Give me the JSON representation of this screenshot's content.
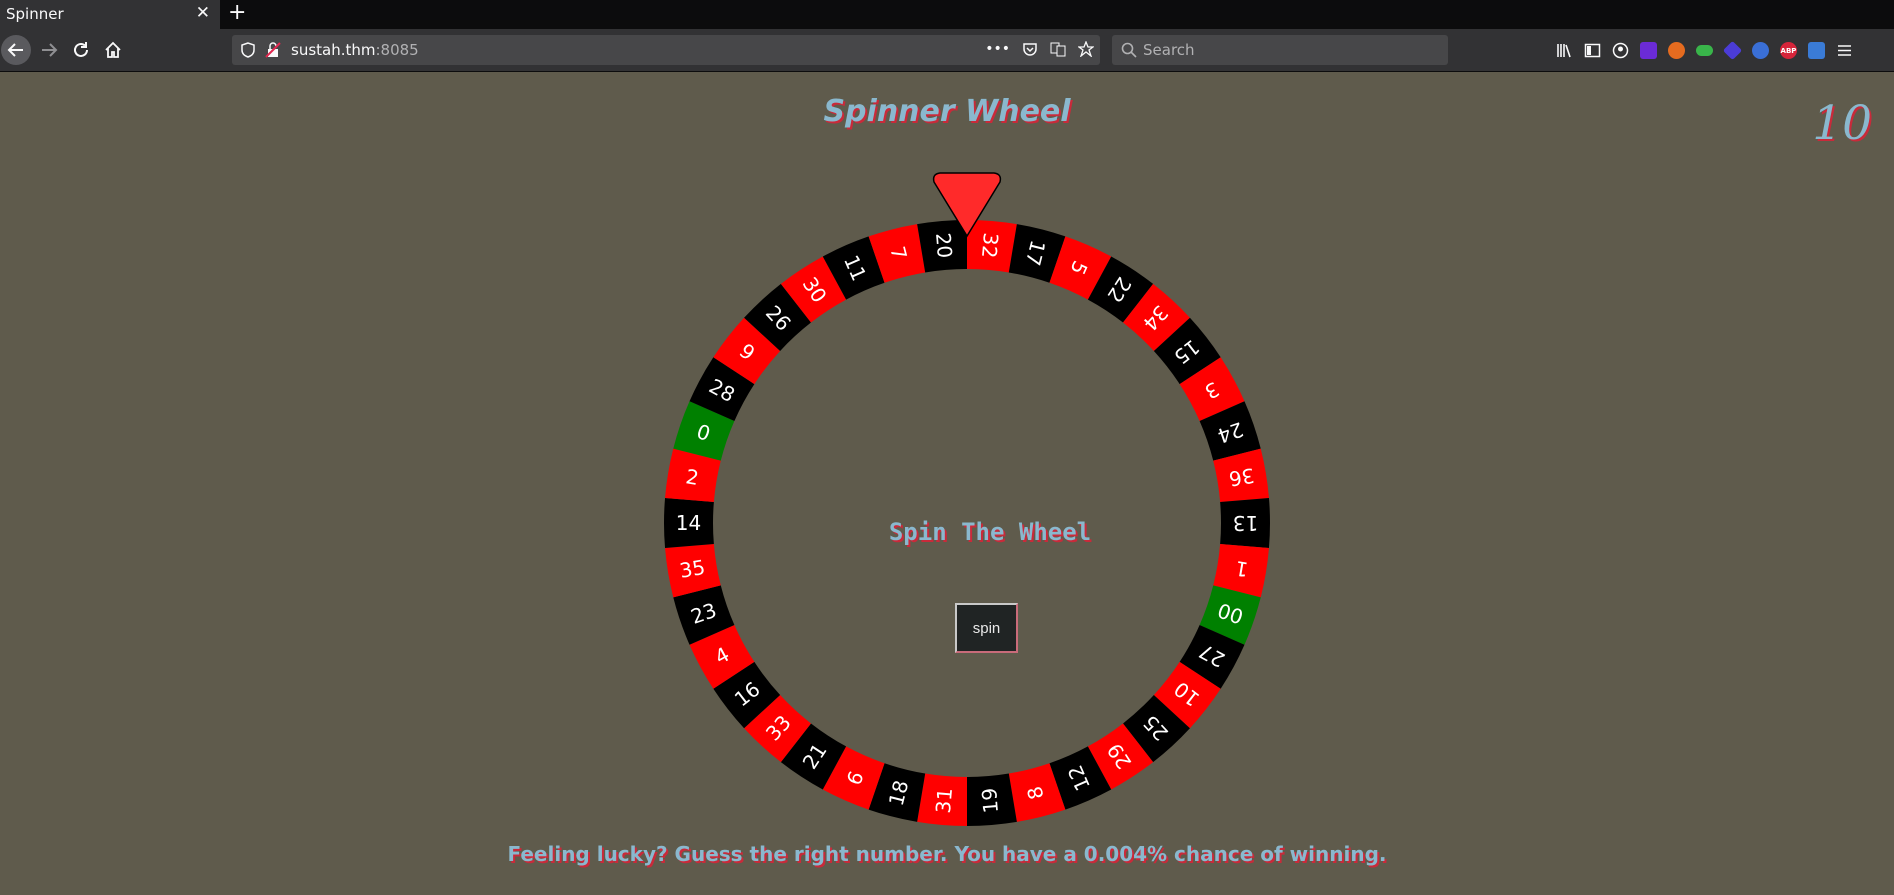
{
  "browser": {
    "tab_title": "Spinner",
    "url_host": "sustah.thm",
    "url_port": ":8085",
    "search_placeholder": "Search"
  },
  "page": {
    "title": "Spinner Wheel",
    "score": "10",
    "spin_heading": "Spin The Wheel",
    "spin_button": "spin",
    "footer": "Feeling lucky? Guess the right number. You have a 0.004% chance of winning."
  },
  "wheel": {
    "pockets": [
      "32",
      "17",
      "5",
      "22",
      "34",
      "15",
      "3",
      "24",
      "36",
      "13",
      "1",
      "00",
      "27",
      "10",
      "25",
      "29",
      "12",
      "8",
      "19",
      "31",
      "18",
      "6",
      "21",
      "33",
      "16",
      "4",
      "23",
      "35",
      "14",
      "2",
      "0",
      "28",
      "9",
      "26",
      "30",
      "11",
      "7",
      "20"
    ],
    "colors": {
      "red": "#ff0000",
      "black": "#000000",
      "green": "#008000",
      "pointer": "#ff2a2a"
    }
  }
}
